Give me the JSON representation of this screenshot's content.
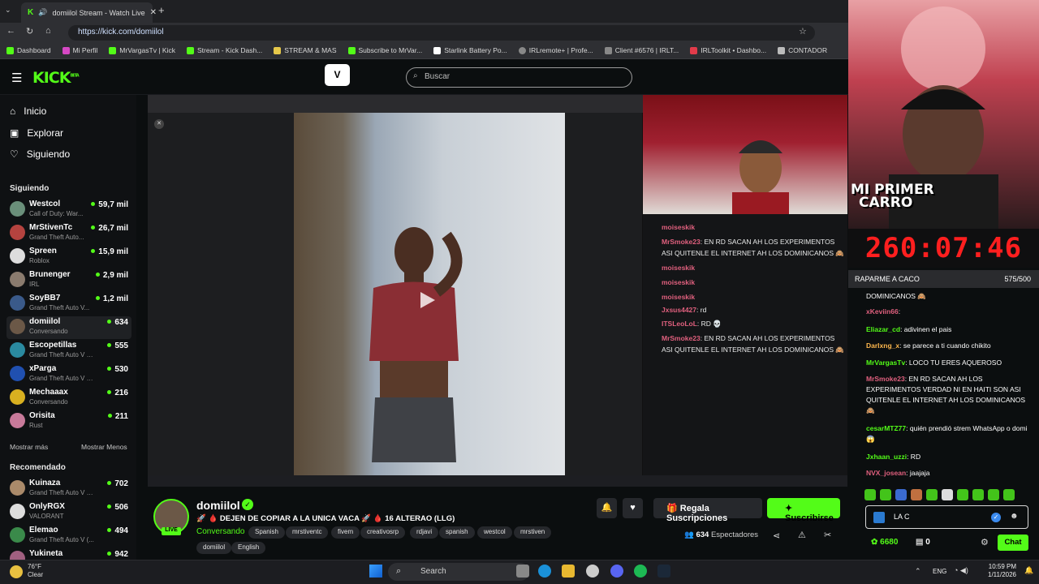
{
  "browser": {
    "tab_title": "domiilol Stream - Watch Live",
    "url": "https://kick.com/domiilol",
    "bookmarks": [
      "Dashboard",
      "Mi Perfil",
      "MrVargasTv | Kick",
      "Stream - Kick Dash...",
      "STREAM & MAS",
      "Subscribe to MrVar...",
      "Starlink Battery Po...",
      "IRLremote+ | Profe...",
      "Client #6576 | IRLT...",
      "IRLToolkit • Dashbo...",
      "CONTADOR"
    ]
  },
  "header": {
    "logo": "KICK",
    "logo_beta": "BETA",
    "search_placeholder": "Buscar"
  },
  "sidebar": {
    "nav": [
      {
        "label": "Inicio"
      },
      {
        "label": "Explorar"
      },
      {
        "label": "Siguiendo"
      }
    ],
    "following_title": "Siguiendo",
    "following": [
      {
        "name": "Westcol",
        "game": "Call of Duty: War...",
        "viewers": "59,7 mil"
      },
      {
        "name": "MrStivenTc",
        "game": "Grand Theft Auto...",
        "viewers": "26,7 mil"
      },
      {
        "name": "Spreen",
        "game": "Roblox",
        "viewers": "15,9 mil"
      },
      {
        "name": "Brunenger",
        "game": "IRL",
        "viewers": "2,9 mil"
      },
      {
        "name": "SoyBB7",
        "game": "Grand Theft Auto V...",
        "viewers": "1,2 mil"
      },
      {
        "name": "domiilol",
        "game": "Conversando",
        "viewers": "634"
      },
      {
        "name": "Escopetillas",
        "game": "Grand Theft Auto V (G...",
        "viewers": "555"
      },
      {
        "name": "xParga",
        "game": "Grand Theft Auto V (G...",
        "viewers": "530"
      },
      {
        "name": "Mechaaax",
        "game": "Conversando",
        "viewers": "216"
      },
      {
        "name": "Orisita",
        "game": "Rust",
        "viewers": "211"
      }
    ],
    "show_more": "Mostrar más",
    "show_less": "Mostrar Menos",
    "recommended_title": "Recomendado",
    "recommended": [
      {
        "name": "Kuinaza",
        "game": "Grand Theft Auto V (G...",
        "viewers": "702"
      },
      {
        "name": "OnlyRGX",
        "game": "VALORANT",
        "viewers": "506"
      },
      {
        "name": "Elemao",
        "game": "Grand Theft Auto V (...",
        "viewers": "494"
      },
      {
        "name": "Yukineta",
        "game": "",
        "viewers": "942"
      }
    ]
  },
  "overlay_chat": [
    {
      "user": "moiseskik",
      "text": "",
      "color": "#e0607e"
    },
    {
      "user": "MrSmoke23",
      "text": ": EN RD SACAN AH LOS EXPERIMENTOS",
      "color": "#e0607e"
    },
    {
      "user": "",
      "text": "ASI QUITENLE EL INTERNET AH LOS DOMINICANOS 🙈",
      "color": "#ffffff"
    },
    {
      "user": "moiseskik",
      "text": "",
      "color": "#e0607e"
    },
    {
      "user": "moiseskik",
      "text": "",
      "color": "#e0607e"
    },
    {
      "user": "moiseskik",
      "text": "",
      "color": "#e0607e"
    },
    {
      "user": "Jxsus4427",
      "text": ": rd",
      "color": "#e0607e"
    },
    {
      "user": "ITSLeoLoL",
      "text": ": RD 💀",
      "color": "#e0607e"
    },
    {
      "user": "MrSmoke23",
      "text": ": EN RD SACAN AH LOS EXPERIMENTOS",
      "color": "#e0607e"
    },
    {
      "user": "",
      "text": "ASI QUITENLE EL INTERNET AH LOS DOMINICANOS 🙈",
      "color": "#ffffff"
    }
  ],
  "stream": {
    "streamer": "domiilol",
    "live": "LIVE",
    "title": "🚀 🩸 DEJEN DE COPIAR A LA UNICA VACA 🚀 🩸 16 ALTERAO (LLG)",
    "category": "Conversando",
    "tags": [
      "Spanish",
      "mrstiventc",
      "fivem",
      "creativosrp",
      "rdjavi",
      "spanish",
      "westcol",
      "mrstiven",
      "domiilol",
      "English"
    ],
    "gift_label": "Regala Suscripciones",
    "subscribe_label": "Suscribirse",
    "viewers_count": "634",
    "viewers_label": "Espectadores"
  },
  "cam": {
    "caption_line1": "MI PRIMER",
    "caption_line2": "CARRO",
    "timer": "260:07:46",
    "goal_label": "RAPARME A CACO",
    "goal_value": "575/500",
    "goal_progress": 1.0
  },
  "chat": {
    "messages": [
      {
        "user": "",
        "text": "DOMINICANOS 🙈",
        "color": "#ffffff"
      },
      {
        "user": "xKeviin66",
        "text": ":",
        "color": "#e0607e"
      },
      {
        "user": "Eliazar_cd",
        "text": ": adivinen el pais",
        "color": "#53fc18"
      },
      {
        "user": "Darlxng_x",
        "text": ": se parece a ti cuando chikito",
        "color": "#ffb84d"
      },
      {
        "user": "MrVargasTv",
        "text": ": LOCO TU ERES AQUEROSO",
        "color": "#53fc18"
      },
      {
        "user": "MrSmoke23",
        "text": ": EN RD SACAN AH LOS EXPERIMENTOS VERDAD NI EN HAITI SON ASI QUITENLE EL INTERNET AH LOS DOMINICANOS 🙈",
        "color": "#e0607e"
      },
      {
        "user": "cesarMTZ77",
        "text": ": quién prendió strem WhatsApp o domi😱",
        "color": "#53fc18"
      },
      {
        "user": "Jxhaan_uzzi",
        "text": ": RD",
        "color": "#53fc18"
      },
      {
        "user": "NVX_josean",
        "text": ": jaajaja",
        "color": "#e0607e"
      }
    ],
    "input_value": "LA C",
    "points": "6680",
    "kicks": "0",
    "send_label": "Chat"
  },
  "taskbar": {
    "weather_temp": "76°F",
    "weather_desc": "Clear",
    "search": "Search",
    "lang": "ENG",
    "time": "10:59 PM",
    "date": "1/11/2026"
  }
}
